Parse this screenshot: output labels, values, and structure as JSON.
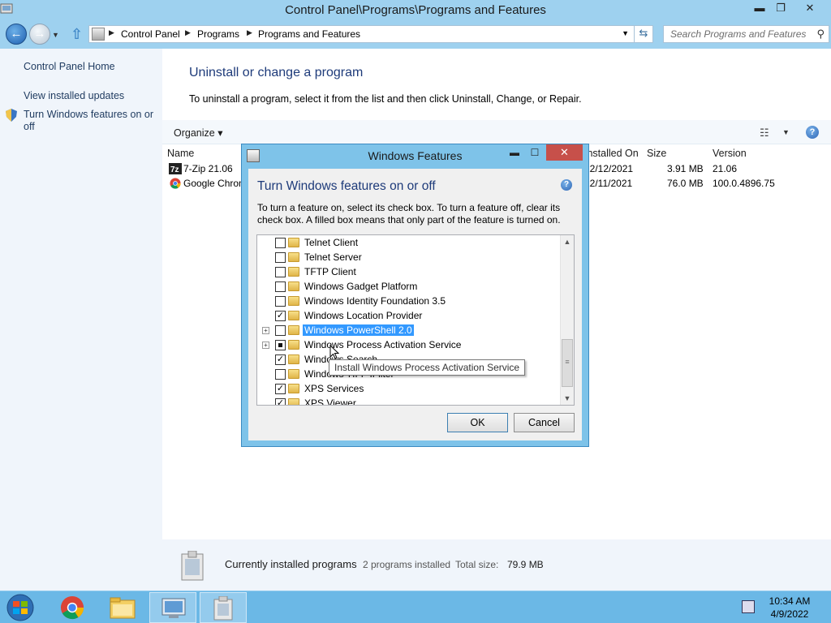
{
  "window": {
    "title": "Control Panel\\Programs\\Programs and Features",
    "minimize": "▬",
    "restore": "❐",
    "close": "✕"
  },
  "address": {
    "crumbs": [
      "Control Panel",
      "Programs",
      "Programs and Features"
    ],
    "search_placeholder": "Search Programs and Features"
  },
  "sidebar": {
    "items": [
      {
        "label": "Control Panel Home"
      },
      {
        "label": "View installed updates"
      },
      {
        "label": "Turn Windows features on or off"
      }
    ]
  },
  "main": {
    "heading": "Uninstall or change a program",
    "subtitle": "To uninstall a program, select it from the list and then click Uninstall, Change, or Repair.",
    "organize": "Organize",
    "columns": {
      "name": "Name",
      "installed_on": "Installed On",
      "size": "Size",
      "version": "Version"
    },
    "programs": [
      {
        "name": "7-Zip 21.06",
        "installed_on": "12/12/2021",
        "size": "3.91 MB",
        "version": "21.06"
      },
      {
        "name": "Google Chrome",
        "installed_on": "12/11/2021",
        "size": "76.0 MB",
        "version": "100.0.4896.75"
      }
    ]
  },
  "footer": {
    "label": "Currently installed programs",
    "count": "2 programs installed",
    "total_label": "Total size:",
    "total_value": "79.9 MB"
  },
  "dialog": {
    "title": "Windows Features",
    "heading": "Turn Windows features on or off",
    "description": "To turn a feature on, select its check box. To turn a feature off, clear its check box. A filled box means that only part of the feature is turned on.",
    "features": [
      {
        "label": "Telnet Client",
        "state": "off",
        "expandable": false
      },
      {
        "label": "Telnet Server",
        "state": "off",
        "expandable": false
      },
      {
        "label": "TFTP Client",
        "state": "off",
        "expandable": false
      },
      {
        "label": "Windows Gadget Platform",
        "state": "off",
        "expandable": false
      },
      {
        "label": "Windows Identity Foundation 3.5",
        "state": "off",
        "expandable": false
      },
      {
        "label": "Windows Location Provider",
        "state": "on",
        "expandable": false
      },
      {
        "label": "Windows PowerShell 2.0",
        "state": "off",
        "expandable": true,
        "selected": true
      },
      {
        "label": "Windows Process Activation Service",
        "state": "partial",
        "expandable": true
      },
      {
        "label": "Windows Search",
        "state": "on",
        "expandable": false
      },
      {
        "label": "Windows TIFF IFilter",
        "state": "off",
        "expandable": false
      },
      {
        "label": "XPS Services",
        "state": "on",
        "expandable": false
      },
      {
        "label": "XPS Viewer",
        "state": "on",
        "expandable": false
      }
    ],
    "ok": "OK",
    "cancel": "Cancel",
    "tooltip": "Install Windows Process Activation Service"
  },
  "taskbar": {
    "time": "10:34 AM",
    "date": "4/9/2022"
  },
  "colors": {
    "accent": "#9ed1ef",
    "heading": "#1e3b7a",
    "selection": "#3399ff",
    "close": "#c7504a"
  }
}
